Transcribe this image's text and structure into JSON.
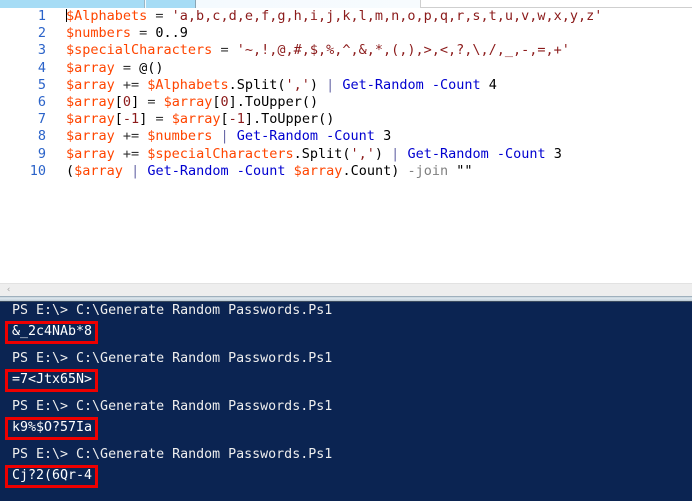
{
  "window": {
    "top_strip": {
      "tab_color": "#a6dcf5",
      "panel_border": "#cfcfcf"
    }
  },
  "editor": {
    "background": "#ffffff",
    "linenumber_color": "#2b63c9",
    "variable_color": "#ff4500",
    "string_color": "#8b1a1a",
    "cmdlet_color": "#0000d0",
    "lines": [
      {
        "number": "1",
        "tokens": [
          {
            "t": "$Alphabets",
            "c": "var"
          },
          {
            "t": " = ",
            "c": "op"
          },
          {
            "t": "'a,b,c,d,e,f,g,h,i,j,k,l,m,n,o,p,q,r,s,t,u,v,w,x,y,z'",
            "c": "str"
          }
        ]
      },
      {
        "number": "2",
        "tokens": [
          {
            "t": "$numbers",
            "c": "var"
          },
          {
            "t": " = ",
            "c": "op"
          },
          {
            "t": "0..9",
            "c": "plain"
          }
        ]
      },
      {
        "number": "3",
        "tokens": [
          {
            "t": "$specialCharacters",
            "c": "var"
          },
          {
            "t": " = ",
            "c": "op"
          },
          {
            "t": "'~,!,@,#,$,%,^,&,*,(,),>,<,?,\\,/,_,-,=,+'",
            "c": "str"
          }
        ]
      },
      {
        "number": "4",
        "tokens": [
          {
            "t": "$array",
            "c": "var"
          },
          {
            "t": " = ",
            "c": "op"
          },
          {
            "t": "@()",
            "c": "plain"
          }
        ]
      },
      {
        "number": "5",
        "tokens": [
          {
            "t": "$array",
            "c": "var"
          },
          {
            "t": " += ",
            "c": "op"
          },
          {
            "t": "$Alphabets",
            "c": "var"
          },
          {
            "t": ".",
            "c": "plain"
          },
          {
            "t": "Split(",
            "c": "plain"
          },
          {
            "t": "','",
            "c": "str"
          },
          {
            "t": ") ",
            "c": "plain"
          },
          {
            "t": "| ",
            "c": "pipe"
          },
          {
            "t": "Get-Random",
            "c": "cmd"
          },
          {
            "t": " ",
            "c": "plain"
          },
          {
            "t": "-Count",
            "c": "cmd"
          },
          {
            "t": " 4",
            "c": "plain"
          }
        ]
      },
      {
        "number": "6",
        "tokens": [
          {
            "t": "$array",
            "c": "var"
          },
          {
            "t": "[",
            "c": "plain"
          },
          {
            "t": "0",
            "c": "idx"
          },
          {
            "t": "]",
            "c": "plain"
          },
          {
            "t": " = ",
            "c": "op"
          },
          {
            "t": "$array",
            "c": "var"
          },
          {
            "t": "[",
            "c": "plain"
          },
          {
            "t": "0",
            "c": "idx"
          },
          {
            "t": "]",
            "c": "plain"
          },
          {
            "t": ".ToUpper()",
            "c": "plain"
          }
        ]
      },
      {
        "number": "7",
        "tokens": [
          {
            "t": "$array",
            "c": "var"
          },
          {
            "t": "[",
            "c": "plain"
          },
          {
            "t": "-1",
            "c": "idx"
          },
          {
            "t": "]",
            "c": "plain"
          },
          {
            "t": " = ",
            "c": "op"
          },
          {
            "t": "$array",
            "c": "var"
          },
          {
            "t": "[",
            "c": "plain"
          },
          {
            "t": "-1",
            "c": "idx"
          },
          {
            "t": "]",
            "c": "plain"
          },
          {
            "t": ".ToUpper()",
            "c": "plain"
          }
        ]
      },
      {
        "number": "8",
        "tokens": [
          {
            "t": "$array",
            "c": "var"
          },
          {
            "t": " += ",
            "c": "op"
          },
          {
            "t": "$numbers",
            "c": "var"
          },
          {
            "t": " ",
            "c": "plain"
          },
          {
            "t": "| ",
            "c": "pipe"
          },
          {
            "t": "Get-Random",
            "c": "cmd"
          },
          {
            "t": " ",
            "c": "plain"
          },
          {
            "t": "-Count",
            "c": "cmd"
          },
          {
            "t": " 3",
            "c": "plain"
          }
        ]
      },
      {
        "number": "9",
        "tokens": [
          {
            "t": "$array",
            "c": "var"
          },
          {
            "t": " += ",
            "c": "op"
          },
          {
            "t": "$specialCharacters",
            "c": "var"
          },
          {
            "t": ".Split(",
            "c": "plain"
          },
          {
            "t": "','",
            "c": "str"
          },
          {
            "t": ") ",
            "c": "plain"
          },
          {
            "t": "| ",
            "c": "pipe"
          },
          {
            "t": "Get-Random",
            "c": "cmd"
          },
          {
            "t": " ",
            "c": "plain"
          },
          {
            "t": "-Count",
            "c": "cmd"
          },
          {
            "t": " 3",
            "c": "plain"
          }
        ]
      },
      {
        "number": "10",
        "tokens": [
          {
            "t": "(",
            "c": "plain"
          },
          {
            "t": "$array",
            "c": "var"
          },
          {
            "t": " ",
            "c": "plain"
          },
          {
            "t": "| ",
            "c": "pipe"
          },
          {
            "t": "Get-Random",
            "c": "cmd"
          },
          {
            "t": " ",
            "c": "plain"
          },
          {
            "t": "-Count",
            "c": "cmd"
          },
          {
            "t": " ",
            "c": "plain"
          },
          {
            "t": "$array",
            "c": "var"
          },
          {
            "t": ".Count)",
            "c": "plain"
          },
          {
            "t": " -join",
            "c": "join"
          },
          {
            "t": " \"\"",
            "c": "plain"
          }
        ]
      }
    ]
  },
  "scrollbar": {
    "left_arrow_glyph": "‹"
  },
  "console": {
    "background": "#0b2452",
    "text_color": "#eeeeee",
    "highlight_color": "#ee0000",
    "runs": [
      {
        "prompt": "PS E:\\> C:\\Generate Random Passwords.Ps1",
        "password": "&_2c4NAb*8"
      },
      {
        "prompt": "PS E:\\> C:\\Generate Random Passwords.Ps1",
        "password": "=7<Jtx65N>"
      },
      {
        "prompt": "PS E:\\> C:\\Generate Random Passwords.Ps1",
        "password": "k9%$O?57Ia"
      },
      {
        "prompt": "PS E:\\> C:\\Generate Random Passwords.Ps1",
        "password": "Cj?2(6Qr-4"
      }
    ]
  }
}
